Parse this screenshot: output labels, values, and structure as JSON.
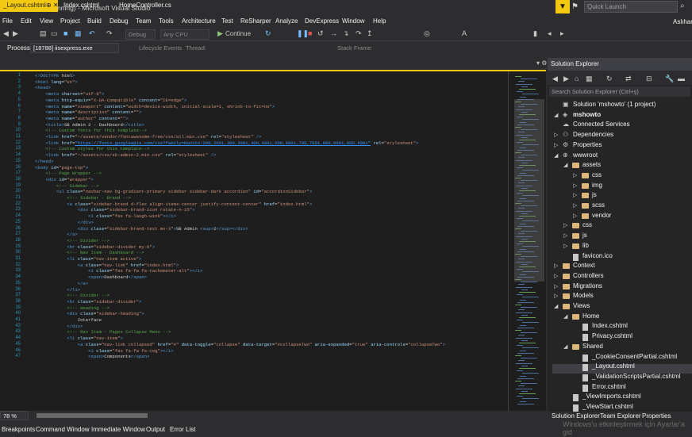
{
  "window": {
    "title": "mshowto (Running) - Microsoft Visual Studio",
    "quick_launch_placeholder": "Quick Launch",
    "user": "Aslıhan"
  },
  "menu": [
    "File",
    "Edit",
    "View",
    "Project",
    "Build",
    "Debug",
    "Team",
    "Tools",
    "Architecture",
    "Test",
    "ReSharper",
    "Analyze",
    "DevExpress",
    "Window",
    "Help"
  ],
  "toolbar": {
    "config": "Debug",
    "platform": "Any CPU",
    "continue_label": "Continue"
  },
  "debug_bar": {
    "process_label": "Process:",
    "process_value": "[18788] iisexpress.exe",
    "lifecycle_label": "Lifecycle Events",
    "thread_label": "Thread:",
    "stack_frame_label": "Stack Frame:"
  },
  "tabs": [
    {
      "label": "_Layout.cshtml",
      "active": true
    },
    {
      "label": "Index.cshtml"
    },
    {
      "label": "HomeController.cs"
    }
  ],
  "editor": {
    "zoom": "78 %",
    "lines": [
      "<!DOCTYPE html>",
      "<html lang=\"en\">",
      "<head>",
      "    <meta charset=\"utf-8\">",
      "    <meta http-equiv=\"X-UA-Compatible\" content=\"IE=edge\">",
      "    <meta name=\"viewport\" content=\"width=device-width, initial-scale=1, shrink-to-fit=no\">",
      "    <meta name=\"description\" content=\"\">",
      "    <meta name=\"author\" content=\"\">",
      "    <title>SB Admin 2 - Dashboard</title>",
      "    <!-- Custom fonts for this template-->",
      "    <link href=\"~/assets/vendor/fontawesome-free/css/all.min.css\" rel=\"stylesheet\" />",
      "    <link href=\"https://fonts.googleapis.com/css?family=Nunito:200,200i,300,300i,400,400i,600,600i,700,700i,800,800i,900,900i\" rel=\"stylesheet\">",
      "    <!-- Custom styles for this template-->",
      "    <link href=\"~/assets/css/sb-admin-2.min.css\" rel=\"stylesheet\" />",
      "</head>",
      "<body id=\"page-top\">",
      "    <!-- Page Wrapper -->",
      "    <div id=\"wrapper\">",
      "        <!-- Sidebar -->",
      "        <ul class=\"navbar-nav bg-gradient-primary sidebar sidebar-dark accordion\" id=\"accordionSidebar\">",
      "            <!-- Sidebar - Brand -->",
      "            <a class=\"sidebar-brand d-flex align-items-center justify-content-center\" href=\"index.html\">",
      "                <div class=\"sidebar-brand-icon rotate-n-15\">",
      "                    <i class=\"fas fa-laugh-wink\"></i>",
      "                </div>",
      "                <div class=\"sidebar-brand-text mx-3\">SB Admin <sup>2</sup></div>",
      "            </a>",
      "            <!-- Divider -->",
      "            <hr class=\"sidebar-divider my-0\">",
      "            <!-- Nav Item - Dashboard -->",
      "            <li class=\"nav-item active\">",
      "                <a class=\"nav-link\" href=\"index.html\">",
      "                    <i class=\"fas fa-fw fa-tachometer-alt\"></i>",
      "                    <span>Dashboard</span>",
      "                </a>",
      "            </li>",
      "            <!-- Divider -->",
      "            <hr class=\"sidebar-divider\">",
      "            <!-- Heading -->",
      "            <div class=\"sidebar-heading\">",
      "                Interface",
      "            </div>",
      "            <!-- Nav Item - Pages Collapse Menu -->",
      "            <li class=\"nav-item\">",
      "                <a class=\"nav-link collapsed\" href=\"#\" data-toggle=\"collapse\" data-target=\"#collapseTwo\" aria-expanded=\"true\" aria-controls=\"collapseTwo\">",
      "                    <i class=\"fas fa-fw fa-cog\"></i>",
      "                    <span>Components</span>"
    ]
  },
  "solution_explorer": {
    "title": "Solution Explorer",
    "search_placeholder": "Search Solution Explorer (Ctrl+ş)",
    "items": [
      {
        "label": "Solution 'mshowto' (1 project)",
        "level": 0,
        "kind": "solution",
        "arrow": ""
      },
      {
        "label": "mshowto",
        "level": 0,
        "kind": "project",
        "arrow": "open",
        "bold": true
      },
      {
        "label": "Connected Services",
        "level": 1,
        "kind": "service",
        "arrow": ""
      },
      {
        "label": "Dependencies",
        "level": 1,
        "kind": "deps",
        "arrow": "closed"
      },
      {
        "label": "Properties",
        "level": 1,
        "kind": "props",
        "arrow": "closed"
      },
      {
        "label": "wwwroot",
        "level": 1,
        "kind": "globe",
        "arrow": "open"
      },
      {
        "label": "assets",
        "level": 2,
        "kind": "folder",
        "arrow": "open"
      },
      {
        "label": "css",
        "level": 3,
        "kind": "folder",
        "arrow": "closed"
      },
      {
        "label": "img",
        "level": 3,
        "kind": "folder",
        "arrow": "closed"
      },
      {
        "label": "js",
        "level": 3,
        "kind": "folder",
        "arrow": "closed"
      },
      {
        "label": "scss",
        "level": 3,
        "kind": "folder",
        "arrow": "closed"
      },
      {
        "label": "vendor",
        "level": 3,
        "kind": "folder",
        "arrow": "closed"
      },
      {
        "label": "css",
        "level": 2,
        "kind": "folder",
        "arrow": "closed"
      },
      {
        "label": "js",
        "level": 2,
        "kind": "folder",
        "arrow": "closed"
      },
      {
        "label": "lib",
        "level": 2,
        "kind": "folder",
        "arrow": "closed"
      },
      {
        "label": "favicon.ico",
        "level": 2,
        "kind": "file",
        "arrow": ""
      },
      {
        "label": "Context",
        "level": 1,
        "kind": "folder",
        "arrow": "closed"
      },
      {
        "label": "Controllers",
        "level": 1,
        "kind": "folder",
        "arrow": "closed"
      },
      {
        "label": "Migrations",
        "level": 1,
        "kind": "folder",
        "arrow": "closed"
      },
      {
        "label": "Models",
        "level": 1,
        "kind": "folder",
        "arrow": "closed"
      },
      {
        "label": "Views",
        "level": 1,
        "kind": "folder",
        "arrow": "open"
      },
      {
        "label": "Home",
        "level": 2,
        "kind": "folder",
        "arrow": "open"
      },
      {
        "label": "Index.cshtml",
        "level": 3,
        "kind": "file",
        "arrow": ""
      },
      {
        "label": "Privacy.cshtml",
        "level": 3,
        "kind": "file",
        "arrow": ""
      },
      {
        "label": "Shared",
        "level": 2,
        "kind": "folder",
        "arrow": "open"
      },
      {
        "label": "_CookieConsentPartial.cshtml",
        "level": 3,
        "kind": "file",
        "arrow": ""
      },
      {
        "label": "_Layout.cshtml",
        "level": 3,
        "kind": "file",
        "arrow": "",
        "selected": true
      },
      {
        "label": "_ValidationScriptsPartial.cshtml",
        "level": 3,
        "kind": "file",
        "arrow": ""
      },
      {
        "label": "Error.cshtml",
        "level": 3,
        "kind": "file",
        "arrow": ""
      },
      {
        "label": "_ViewImports.cshtml",
        "level": 2,
        "kind": "file",
        "arrow": ""
      },
      {
        "label": "_ViewStart.cshtml",
        "level": 2,
        "kind": "file",
        "arrow": ""
      }
    ],
    "bottom_tabs": [
      "Solution Explorer",
      "Team Explorer",
      "Properties"
    ]
  },
  "status_tabs": [
    "Breakpoints",
    "Command Window",
    "Immediate Window",
    "Output",
    "Error List"
  ],
  "watermark": "Windows'u etkinleştirmek için Ayarlar'a gid",
  "colors": {
    "accent": "#f2c811",
    "background": "#2d2d30",
    "editor": "#1e1e1e"
  }
}
